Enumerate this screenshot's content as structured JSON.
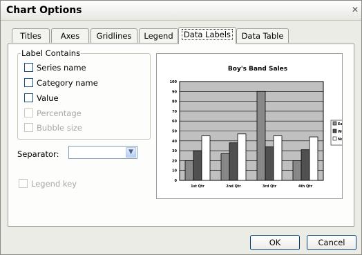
{
  "window": {
    "title": "Chart Options"
  },
  "tabs": [
    {
      "label": "Titles"
    },
    {
      "label": "Axes"
    },
    {
      "label": "Gridlines"
    },
    {
      "label": "Legend"
    },
    {
      "label": "Data Labels"
    },
    {
      "label": "Data Table"
    }
  ],
  "active_tab": "Data Labels",
  "label_contains": {
    "heading": "Label Contains",
    "options": [
      {
        "label": "Series name",
        "checked": false,
        "enabled": true
      },
      {
        "label": "Category name",
        "checked": false,
        "enabled": true
      },
      {
        "label": "Value",
        "checked": false,
        "enabled": true
      },
      {
        "label": "Percentage",
        "checked": false,
        "enabled": false
      },
      {
        "label": "Bubble size",
        "checked": false,
        "enabled": false
      }
    ]
  },
  "separator": {
    "label": "Separator:",
    "value": ""
  },
  "legend_key": {
    "label": "Legend key",
    "checked": false,
    "enabled": false
  },
  "buttons": {
    "ok": "OK",
    "cancel": "Cancel"
  },
  "colors": {
    "plot_area": "#c0c0c0",
    "east": "#888888",
    "west": "#505050",
    "north": "#ffffff"
  },
  "chart_data": {
    "type": "bar",
    "title": "Boy's Band Sales",
    "categories": [
      "1st Qtr",
      "2nd Qtr",
      "3rd Qtr",
      "4th Qtr"
    ],
    "series": [
      {
        "name": "East",
        "values": [
          20,
          27,
          90,
          20
        ]
      },
      {
        "name": "West",
        "values": [
          30,
          38,
          34,
          31
        ]
      },
      {
        "name": "North",
        "values": [
          45,
          47,
          45,
          44
        ]
      }
    ],
    "ylim": [
      0,
      100
    ],
    "yticks": [
      0,
      10,
      20,
      30,
      40,
      50,
      60,
      70,
      80,
      90,
      100
    ],
    "grid": true,
    "legend": "right"
  }
}
